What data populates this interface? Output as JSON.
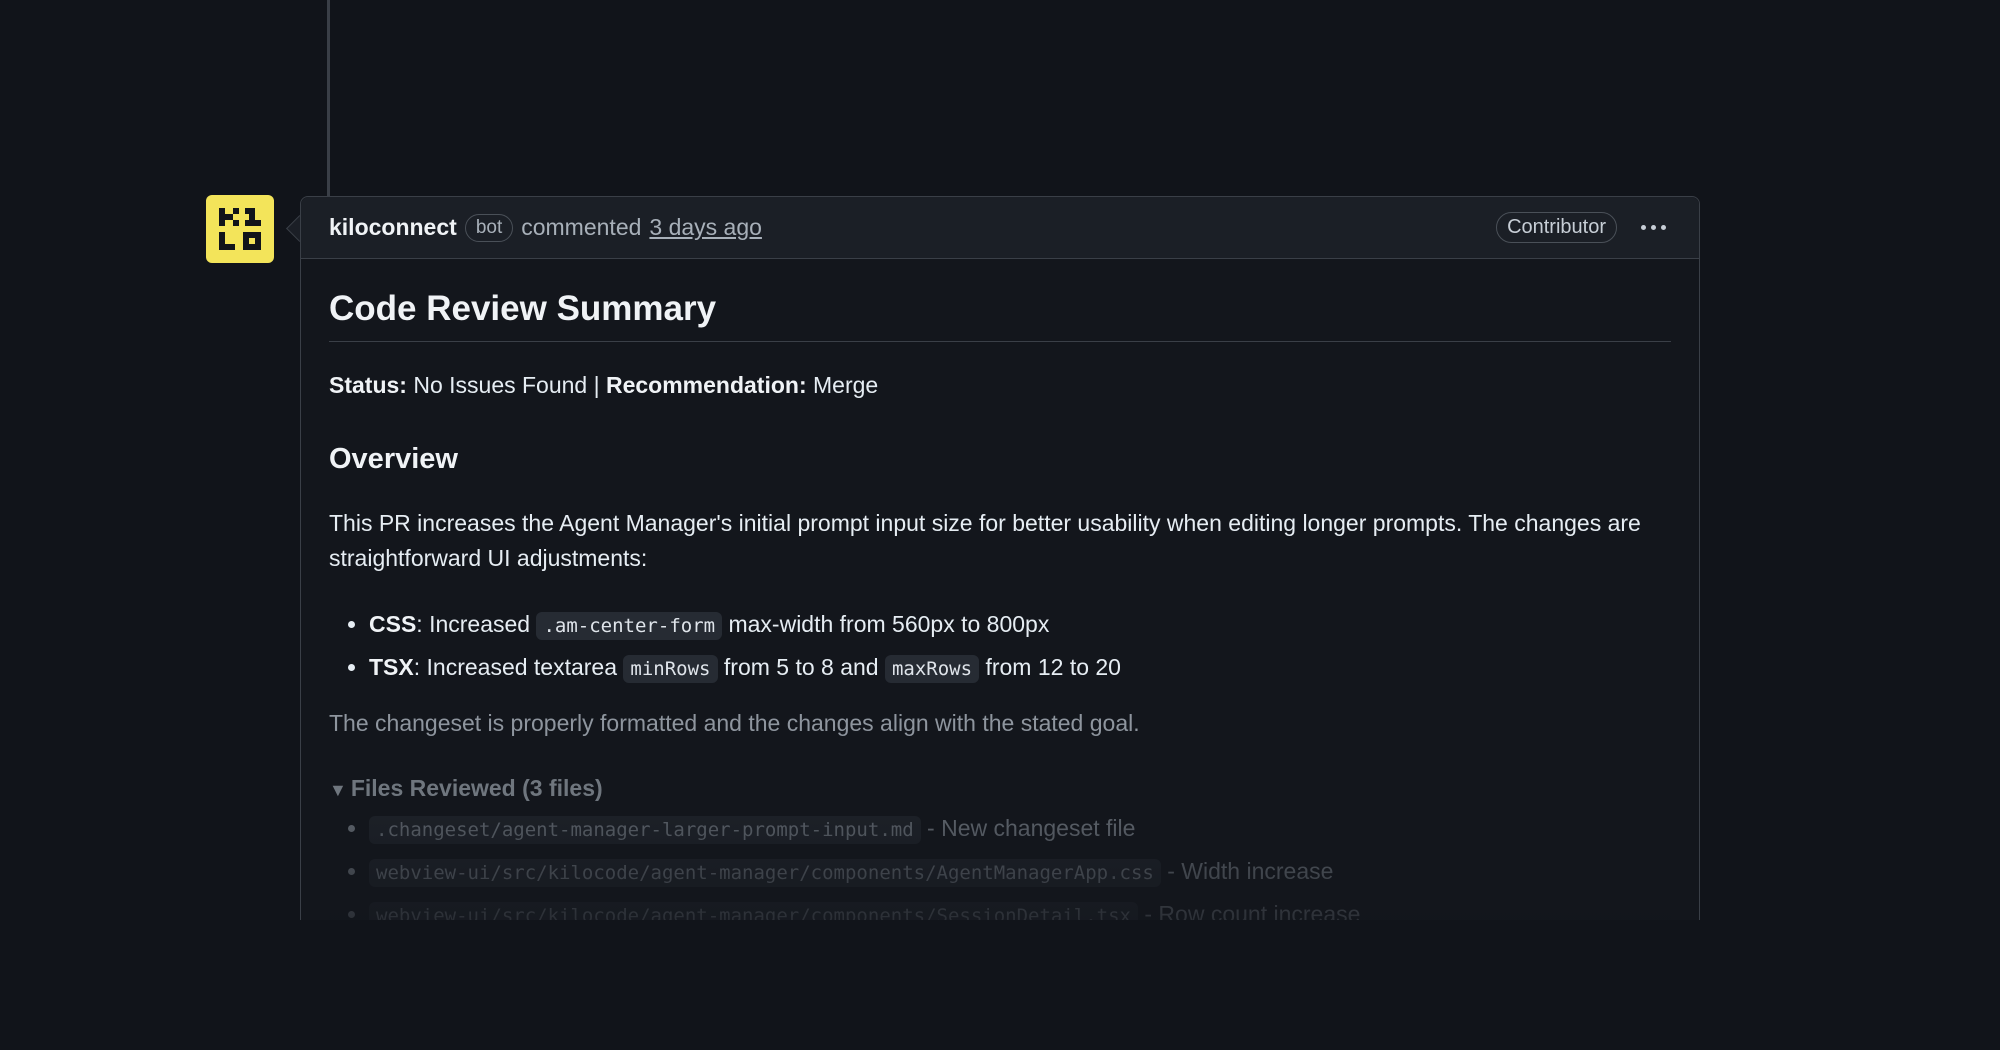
{
  "comment": {
    "author": "kiloconnect",
    "bot_badge": "bot",
    "action": "commented",
    "time": "3 days ago",
    "role_badge": "Contributor",
    "avatar_icon": "kilo-logo-icon",
    "avatar_color": "#f3e45a"
  },
  "review": {
    "title": "Code Review Summary",
    "status_label": "Status:",
    "status_value": "No Issues Found",
    "separator": "|",
    "recommendation_label": "Recommendation:",
    "recommendation_value": "Merge",
    "overview_heading": "Overview",
    "overview_text": "This PR increases the Agent Manager's initial prompt input size for better usability when editing longer prompts. The changes are straightforward UI adjustments:",
    "changes": [
      {
        "label": "CSS",
        "text_a": ": Increased ",
        "code_a": ".am-center-form",
        "text_b": " max-width from 560px to 800px"
      },
      {
        "label": "TSX",
        "text_a": ": Increased textarea ",
        "code_a": "minRows",
        "text_b": " from 5 to 8 and ",
        "code_b": "maxRows",
        "text_c": " from 12 to 20"
      }
    ],
    "conclusion": "The changeset is properly formatted and the changes align with the stated goal.",
    "files_summary": "Files Reviewed (3 files)",
    "files": [
      {
        "path": ".changeset/agent-manager-larger-prompt-input.md",
        "note": " - New changeset file"
      },
      {
        "path": "webview-ui/src/kilocode/agent-manager/components/AgentManagerApp.css",
        "note": " - Width increase"
      },
      {
        "path": "webview-ui/src/kilocode/agent-manager/components/SessionDetail.tsx",
        "note": " - Row count increase"
      }
    ]
  }
}
